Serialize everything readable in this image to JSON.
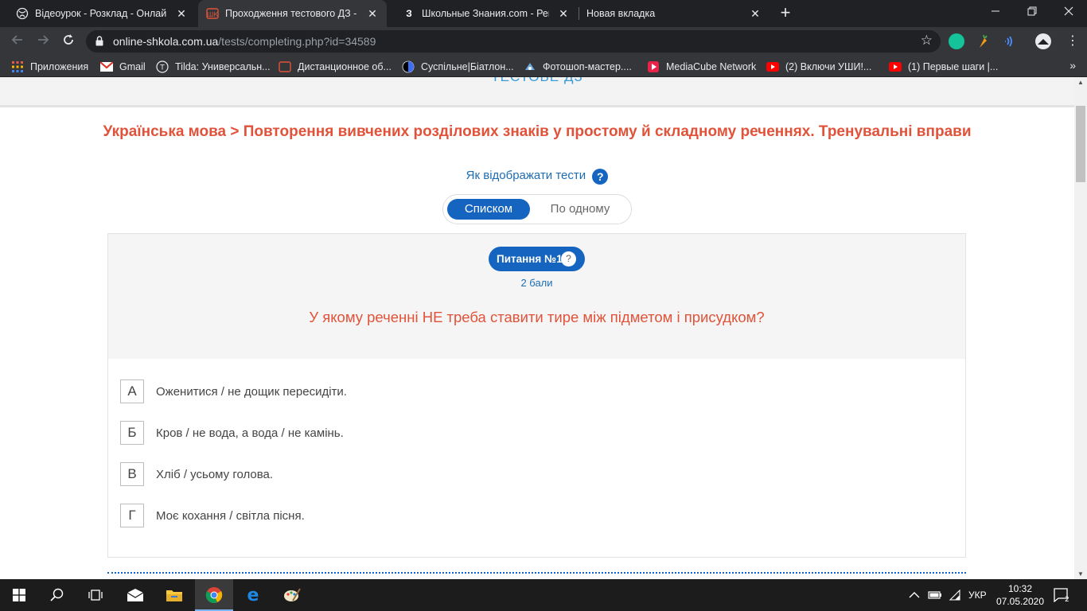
{
  "browser": {
    "tabs": [
      {
        "title": "Відеоурок - Розклад - Онлайн-Ш",
        "favicon": "globe-icon",
        "active": false
      },
      {
        "title": "Проходження тестового ДЗ - Он",
        "favicon": "school-logo-icon",
        "active": true
      },
      {
        "title": "Школьные Знания.com - Решаем",
        "favicon": "znanija-icon",
        "active": false
      },
      {
        "title": "Новая вкладка",
        "favicon": "",
        "active": false
      }
    ],
    "new_tab_glyph": "+",
    "url_host": "online-shkola.com.ua",
    "url_path": "/tests/completing.php?id=34589",
    "bookmarks": [
      {
        "label": "Приложения",
        "icon": "apps-grid-icon"
      },
      {
        "label": "Gmail",
        "icon": "gmail-icon"
      },
      {
        "label": "Tilda: Универсальн...",
        "icon": "tilda-icon"
      },
      {
        "label": "Дистанционное об...",
        "icon": "school-logo-icon"
      },
      {
        "label": "Суспільне|Біатлон...",
        "icon": "suspilne-icon"
      },
      {
        "label": "Фотошоп-мастер....",
        "icon": "photoshop-master-icon"
      },
      {
        "label": "MediaCube Network",
        "icon": "mediacube-icon"
      },
      {
        "label": "(2) Включи УШИ!...",
        "icon": "youtube-icon"
      },
      {
        "label": "(1) Первые шаги |...",
        "icon": "youtube-icon"
      }
    ],
    "bookmarks_more": "»"
  },
  "page": {
    "header": "ТЕСТОВЕ ДЗ",
    "lesson_title": "Українська мова > Повторення вивчених розділових знаків у простому й складному реченнях. Тренувальні вправи",
    "display_mode_label": "Як відображати тести",
    "help_glyph": "?",
    "mode_list": "Списком",
    "mode_single": "По одному",
    "question": {
      "badge": "Питання №1",
      "points": "2 бали",
      "text": "У якому реченні НЕ треба ставити тире між підметом і присудком?",
      "answers": [
        {
          "letter": "А",
          "text": "Оженитися / не дощик пересидіти."
        },
        {
          "letter": "Б",
          "text": "Кров / не вода, а вода / не камінь."
        },
        {
          "letter": "В",
          "text": "Хліб / усьому голова."
        },
        {
          "letter": "Г",
          "text": "Моє кохання / світла пісня."
        }
      ]
    }
  },
  "taskbar": {
    "language": "УКР",
    "time": "10:32",
    "date": "07.05.2020",
    "notifications": "2"
  },
  "colors": {
    "accent_blue": "#1565c0",
    "title_red": "#e0533a",
    "chrome_dark": "#202124",
    "chrome_toolbar": "#35363a"
  }
}
